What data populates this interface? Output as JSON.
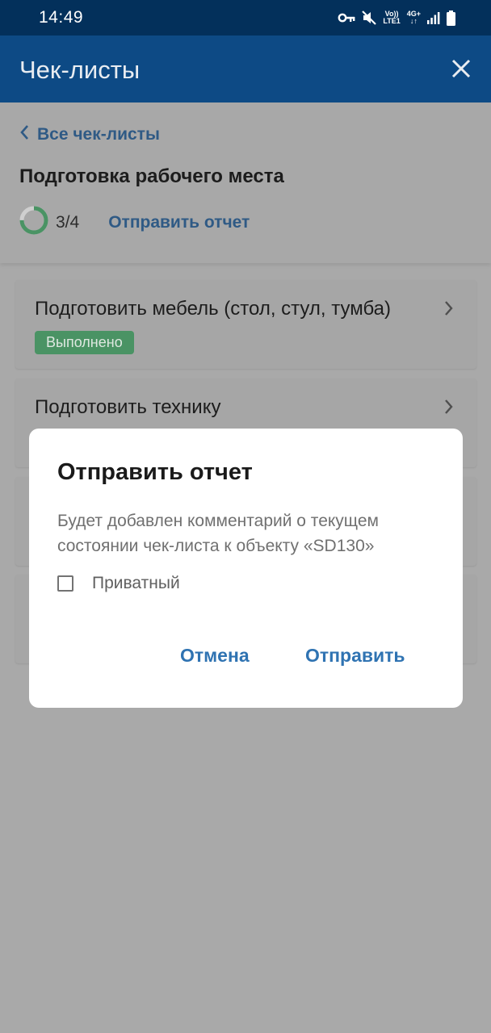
{
  "status_bar": {
    "time": "14:49",
    "icons": [
      "key-icon",
      "mute-icon",
      "volte-icon",
      "4g-icon",
      "signal-icon",
      "battery-icon"
    ],
    "volte_top": "Vo))",
    "volte_bottom": "LTE1",
    "network_top": "4G+",
    "network_bottom": "↓↑"
  },
  "app_bar": {
    "title": "Чек-листы",
    "close_icon": "close-icon"
  },
  "header": {
    "back_label": "Все чек-листы",
    "checklist_title": "Подготовка рабочего места",
    "progress_text": "3/4",
    "progress_fraction": 0.75,
    "send_report_label": "Отправить отчет"
  },
  "list": {
    "items": [
      {
        "title": "Подготовить мебель (стол, стул, тумба)",
        "status": "Выполнено"
      },
      {
        "title": "Подготовить технику"
      }
    ]
  },
  "dialog": {
    "title": "Отправить отчет",
    "message": "Будет добавлен комментарий о текущем состоянии чек-листа к объекту «SD130»",
    "private_label": "Приватный",
    "private_checked": false,
    "cancel_label": "Отмена",
    "submit_label": "Отправить"
  },
  "colors": {
    "status_bar": "#03305b",
    "app_bar": "#0d4a85",
    "scrim_background": "#a9a9a9",
    "link": "#2f5a85",
    "dialog_button": "#2f73b2",
    "badge_done": "#4a9364",
    "progress_done": "#4a9364",
    "progress_remaining": "#cfcfcf"
  }
}
